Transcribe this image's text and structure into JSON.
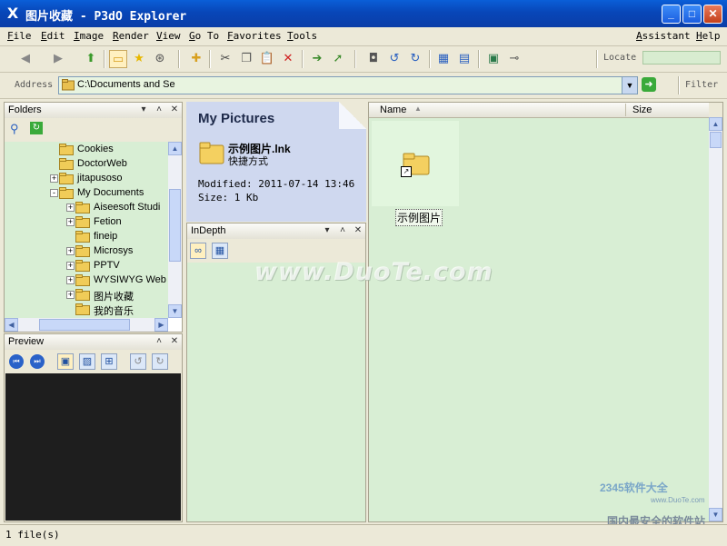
{
  "window": {
    "title": "图片收藏 - P3dO Explorer",
    "app_icon": "X"
  },
  "menu": {
    "left": [
      "File",
      "Edit",
      "Image",
      "Render",
      "View",
      "Go To",
      "Favorites",
      "Tools"
    ],
    "right": [
      "Assistant",
      "Help"
    ]
  },
  "toolbar": {
    "locate_label": "Locate",
    "filter_label": "Filter"
  },
  "address": {
    "label": "Address",
    "value": "C:\\Documents and Se"
  },
  "folders": {
    "title": "Folders",
    "tree": [
      {
        "label": "Cookies",
        "expander": ""
      },
      {
        "label": "DoctorWeb",
        "expander": ""
      },
      {
        "label": "jitapusoso",
        "expander": "+"
      },
      {
        "label": "My Documents",
        "expander": "-"
      },
      {
        "label": "Aiseesoft Studi",
        "expander": "+"
      },
      {
        "label": "Fetion",
        "expander": "+"
      },
      {
        "label": "fineip",
        "expander": ""
      },
      {
        "label": "Microsys",
        "expander": "+"
      },
      {
        "label": "PPTV",
        "expander": "+"
      },
      {
        "label": "WYSIWYG Web",
        "expander": "+"
      },
      {
        "label": "图片收藏",
        "expander": "+"
      },
      {
        "label": "我的音乐",
        "expander": ""
      }
    ]
  },
  "preview": {
    "title": "Preview"
  },
  "info": {
    "title": "My Pictures",
    "filename": "示例图片.lnk",
    "filetype": "快捷方式",
    "modified": "Modified: 2011-07-14 13:46",
    "size": "Size: 1 Kb"
  },
  "indepth": {
    "title": "InDepth"
  },
  "list": {
    "columns": {
      "name": "Name",
      "size": "Size"
    },
    "items": [
      {
        "label": "示例图片"
      }
    ]
  },
  "status": {
    "text": "1 file(s)"
  },
  "watermark": {
    "text": "www.DuoTe.com",
    "corner_logo": "2345软件大全",
    "corner_url": "www.DuoTe.com",
    "corner_slogan": "国内最安全的软件站"
  },
  "colors": {
    "titlebar": "#0846b8",
    "tree_bg": "#d8eed4",
    "info_bg": "#cfd8ef",
    "accent_green": "#3aaa3a"
  }
}
